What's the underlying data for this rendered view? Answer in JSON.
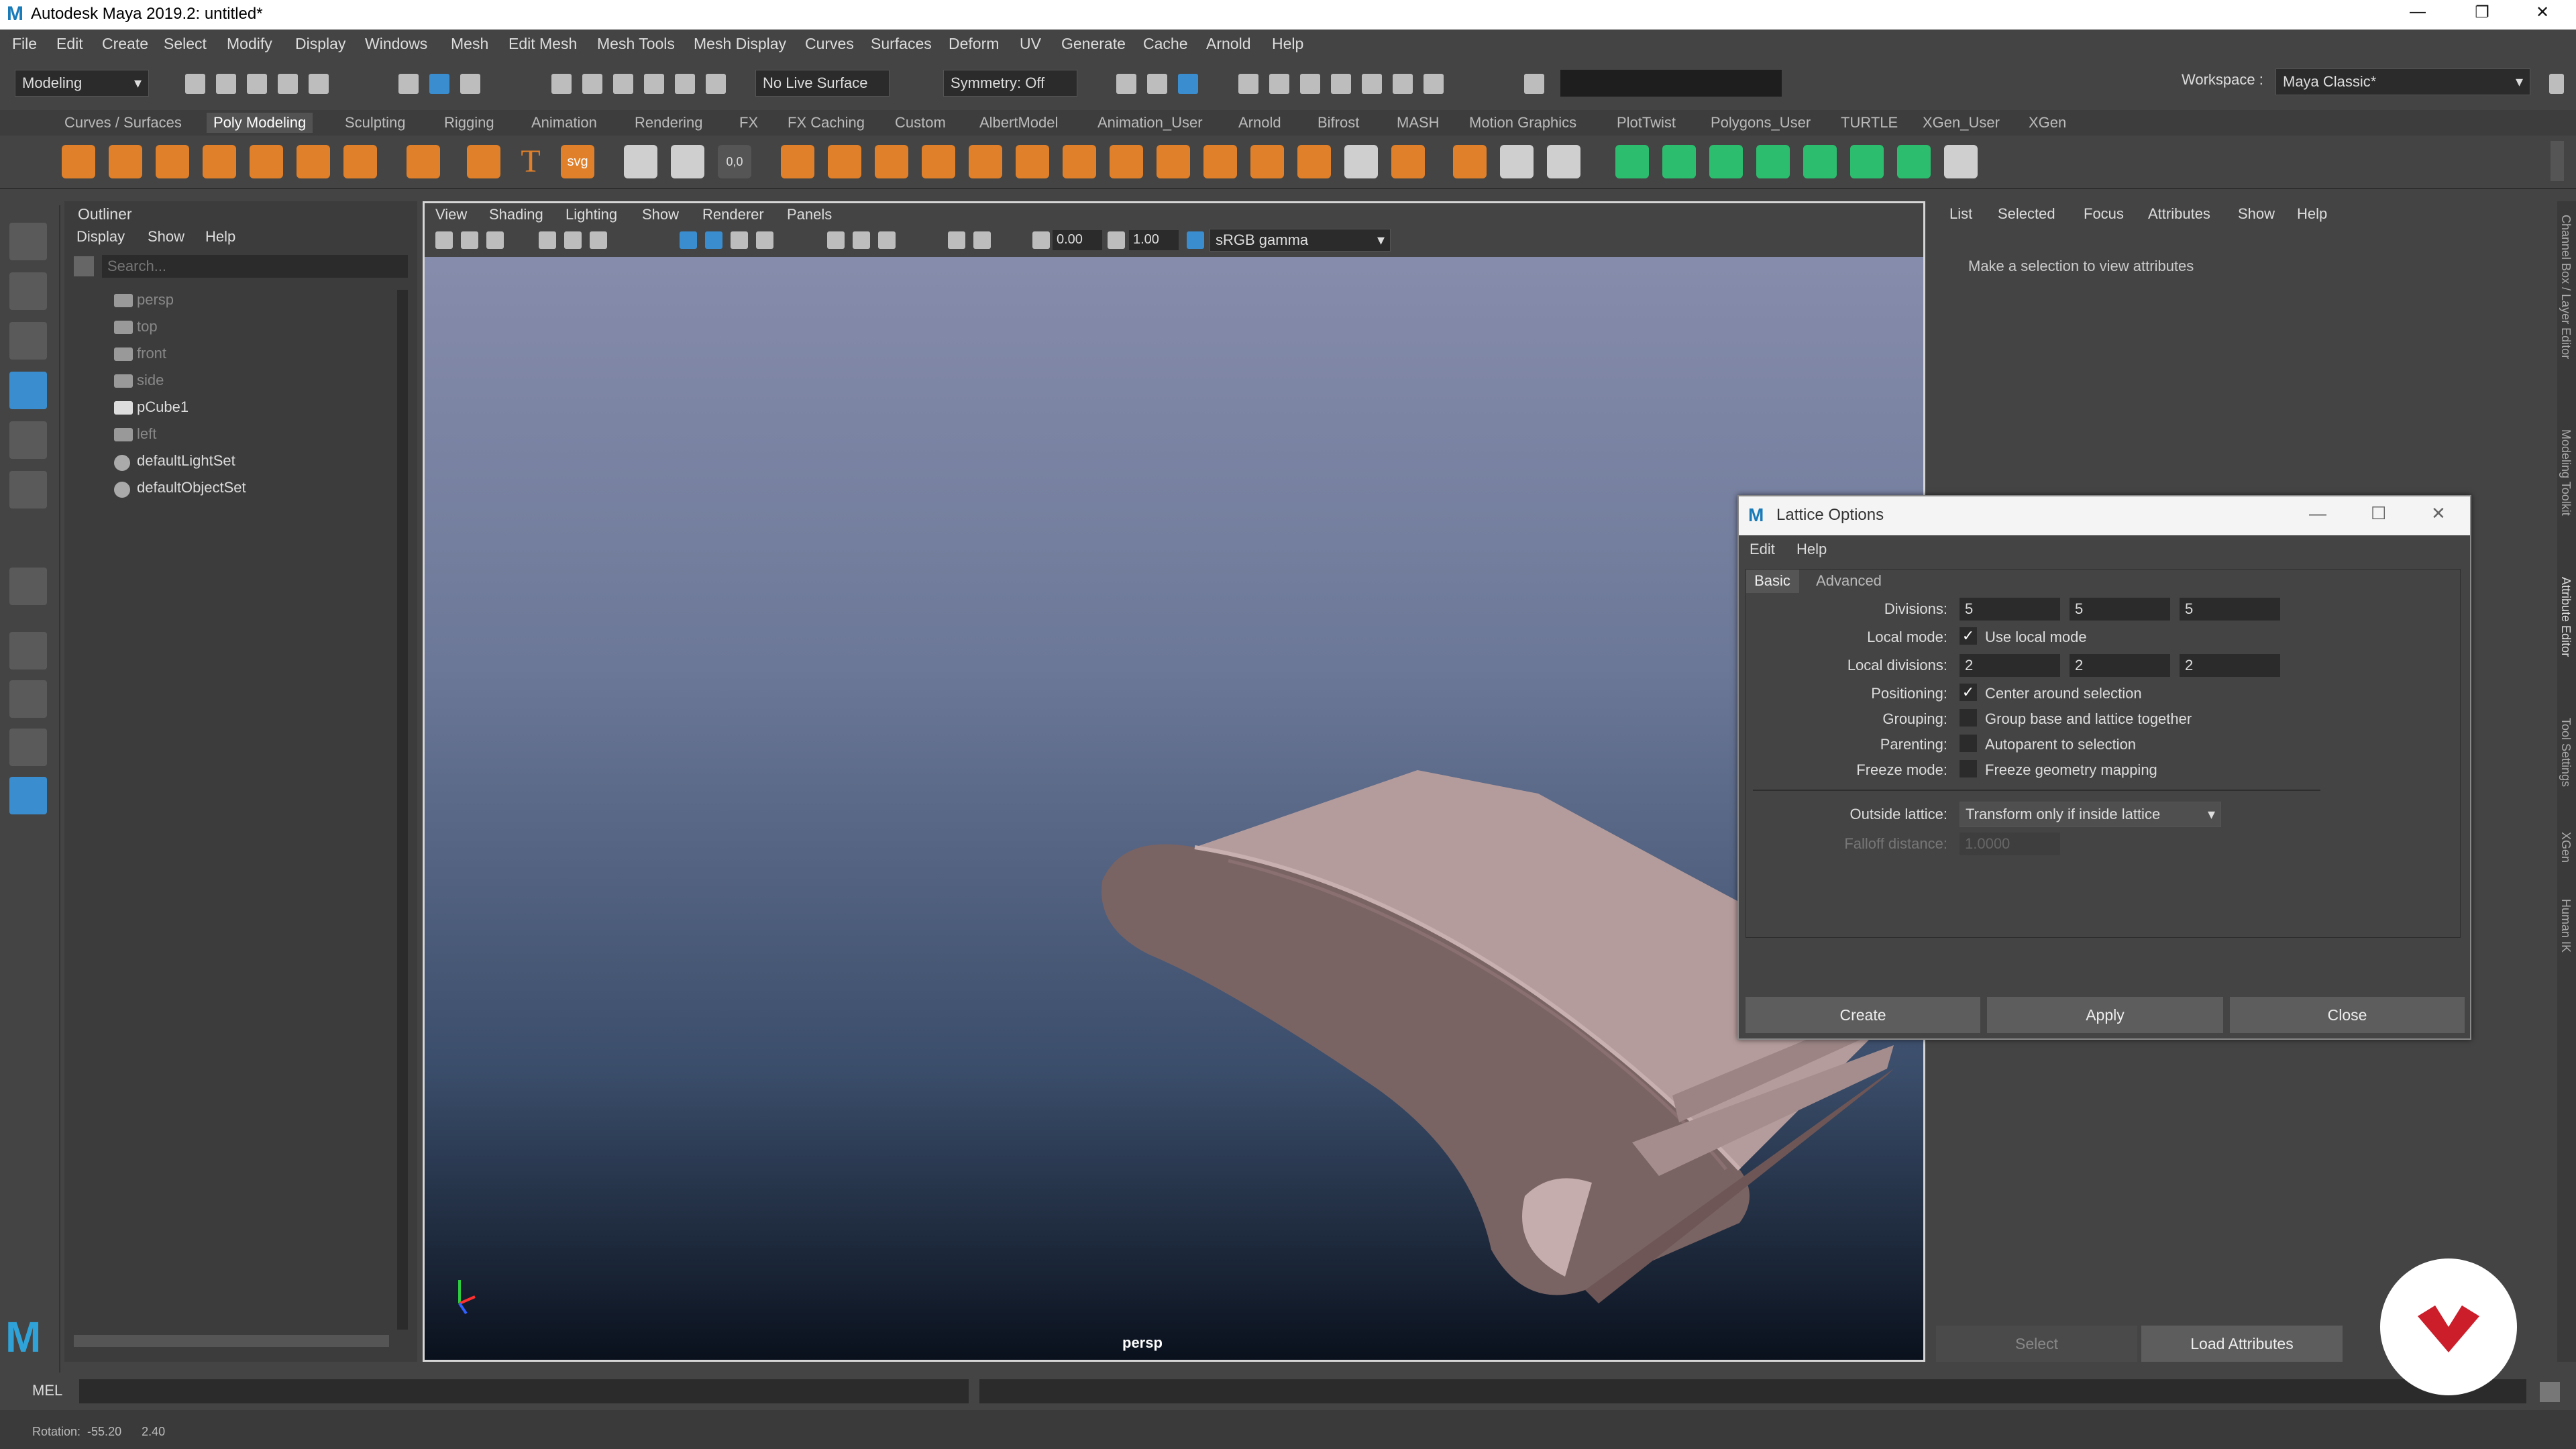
{
  "window": {
    "title": "Autodesk Maya 2019.2: untitled*",
    "controls": {
      "min": "—",
      "max": "❐",
      "close": "✕"
    }
  },
  "menu": [
    "File",
    "Edit",
    "Create",
    "Select",
    "Modify",
    "Display",
    "Windows",
    "Mesh",
    "Edit Mesh",
    "Mesh Tools",
    "Mesh Display",
    "Curves",
    "Surfaces",
    "Deform",
    "UV",
    "Generate",
    "Cache",
    "Arnold",
    "Help"
  ],
  "status": {
    "mode": "Modeling",
    "live_surface": "No Live Surface",
    "symmetry": "Symmetry: Off",
    "workspace_label": "Workspace :",
    "workspace": "Maya Classic*"
  },
  "shelf_tabs": [
    "Curves / Surfaces",
    "Poly Modeling",
    "Sculpting",
    "Rigging",
    "Animation",
    "Rendering",
    "FX",
    "FX Caching",
    "Custom",
    "AlbertModel",
    "Animation_User",
    "Arnold",
    "Bifrost",
    "MASH",
    "Motion Graphics",
    "PlotTwist",
    "Polygons_User",
    "TURTLE",
    "XGen_User",
    "XGen"
  ],
  "shelf_text_icons": {
    "t": "T",
    "svg": "svg",
    "num": "0,0"
  },
  "outliner": {
    "title": "Outliner",
    "menu": [
      "Display",
      "Show",
      "Help"
    ],
    "search_placeholder": "Search...",
    "items": [
      {
        "label": "persp",
        "dim": true,
        "icon": "camera-icon"
      },
      {
        "label": "top",
        "dim": true,
        "icon": "camera-icon"
      },
      {
        "label": "front",
        "dim": true,
        "icon": "camera-icon"
      },
      {
        "label": "side",
        "dim": true,
        "icon": "camera-icon"
      },
      {
        "label": "pCube1",
        "dim": false,
        "icon": "mesh-icon"
      },
      {
        "label": "left",
        "dim": true,
        "icon": "camera-icon"
      },
      {
        "label": "defaultLightSet",
        "dim": false,
        "icon": "set-icon"
      },
      {
        "label": "defaultObjectSet",
        "dim": false,
        "icon": "set-icon"
      }
    ]
  },
  "viewport": {
    "menu": [
      "View",
      "Shading",
      "Lighting",
      "Show",
      "Renderer",
      "Panels"
    ],
    "exposure": "0.00",
    "gamma": "1.00",
    "colorspace": "sRGB gamma",
    "camera_label": "persp"
  },
  "attribute_editor": {
    "menu": [
      "List",
      "Selected",
      "Focus",
      "Attributes",
      "Show",
      "Help"
    ],
    "message": "Make a selection to view attributes",
    "select_btn": "Select",
    "load_btn": "Load Attributes"
  },
  "right_strip": [
    "Channel Box / Layer Editor",
    "Modeling Toolkit",
    "Attribute Editor",
    "Tool Settings",
    "XGen",
    "Human IK"
  ],
  "dialog": {
    "title": "Lattice Options",
    "menu": [
      "Edit",
      "Help"
    ],
    "tabs": [
      "Basic",
      "Advanced"
    ],
    "divisions_label": "Divisions:",
    "divisions": [
      "5",
      "5",
      "5"
    ],
    "local_mode_label": "Local mode:",
    "local_mode": "Use local mode",
    "local_mode_checked": true,
    "local_divisions_label": "Local divisions:",
    "local_divisions": [
      "2",
      "2",
      "2"
    ],
    "positioning_label": "Positioning:",
    "positioning": "Center around selection",
    "positioning_checked": true,
    "grouping_label": "Grouping:",
    "grouping": "Group base and lattice together",
    "grouping_checked": false,
    "parenting_label": "Parenting:",
    "parenting": "Autoparent to selection",
    "parenting_checked": false,
    "freeze_label": "Freeze mode:",
    "freeze": "Freeze geometry mapping",
    "freeze_checked": false,
    "outside_label": "Outside lattice:",
    "outside": "Transform only if inside lattice",
    "falloff_label": "Falloff distance:",
    "falloff": "1.0000",
    "buttons": {
      "create": "Create",
      "apply": "Apply",
      "close": "Close"
    }
  },
  "cmdline": {
    "lang": "MEL"
  },
  "helpline": {
    "text": "Rotation:  -55.20      2.40"
  },
  "colors": {
    "accent": "#3a8dcf",
    "shelf_orange": "#e0802a",
    "brand_red": "#cc1d2a"
  }
}
